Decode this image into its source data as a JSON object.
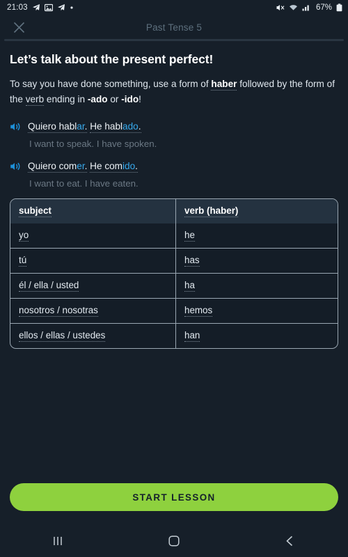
{
  "statusbar": {
    "time": "21:03",
    "battery": "67%",
    "icons": [
      "telegram-send-icon",
      "image-icon",
      "telegram-send-icon",
      "dot-icon"
    ],
    "right_icons": [
      "mute-icon",
      "wifi-icon",
      "cellular-signal-icon",
      "battery-icon"
    ]
  },
  "appbar": {
    "close_label": "×",
    "title": "Past Tense 5"
  },
  "lesson": {
    "heading": "Let’s talk about the present perfect!",
    "intro": {
      "part1": "To say you have done something, use a form of ",
      "haber": "haber",
      "part2": " followed by the form of the ",
      "verb": "verb",
      "part3": " ending in ",
      "ado": "-ado",
      "part4": " or ",
      "ido": "-ido",
      "part5": "!"
    },
    "examples": [
      {
        "seg1_pre": "Quiero habl",
        "seg1_hl": "ar",
        "seg1_post": ".",
        "seg2_pre": "He habl",
        "seg2_hl": "ado",
        "seg2_post": ".",
        "translation": "I want to speak. I have spoken.",
        "audio_icon": "speaker-icon"
      },
      {
        "seg1_pre": "Quiero com",
        "seg1_hl": "er",
        "seg1_post": ".",
        "seg2_pre": "He com",
        "seg2_hl": "ido",
        "seg2_post": ".",
        "translation": "I want to eat. I have eaten.",
        "audio_icon": "speaker-icon"
      }
    ],
    "table": {
      "headers": [
        "subject",
        "verb (haber)"
      ],
      "rows": [
        {
          "subject": "yo",
          "verb": "he"
        },
        {
          "subject": "tú",
          "verb": "has"
        },
        {
          "subject": "él / ella / usted",
          "verb": "ha"
        },
        {
          "subject": "nosotros / nosotras",
          "verb": "hemos"
        },
        {
          "subject": "ellos / ellas / ustedes",
          "verb": "han"
        }
      ]
    }
  },
  "cta": {
    "label": "START LESSON"
  },
  "navbar": {
    "recents_label": "recents-icon",
    "home_label": "home-icon",
    "back_label": "back-icon"
  },
  "colors": {
    "background": "#161f29",
    "accent_green": "#8ed13e",
    "highlight_blue": "#37a9ec",
    "muted_text": "#6b7884",
    "table_header_bg": "#243240",
    "table_border": "#9aa7b2"
  }
}
